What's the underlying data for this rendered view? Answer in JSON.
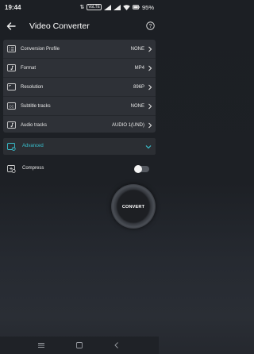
{
  "status_bar": {
    "time": "19:44",
    "battery": "95%",
    "icons": [
      "network-speed-icon",
      "volte-icon",
      "signal-icon",
      "signal-icon",
      "wifi-icon",
      "battery-icon"
    ]
  },
  "app_bar": {
    "title": "Video Converter",
    "back_icon": "arrow-left-icon",
    "help_icon": "question-circle-icon"
  },
  "settings": [
    {
      "label": "Conversion Profile",
      "value": "NONE",
      "icon": "list-box-icon"
    },
    {
      "label": "Format",
      "value": "MP4",
      "icon": "music-note-icon"
    },
    {
      "label": "Resolution",
      "value": "896P",
      "icon": "screen-icon"
    },
    {
      "label": "Subtitle tracks",
      "value": "NONE",
      "icon": "cc-icon"
    },
    {
      "label": "Audio tracks",
      "value": "AUDIO 1(UND)",
      "icon": "music-note-icon"
    }
  ],
  "advanced": {
    "label": "Advanced",
    "accent_color": "#39c1cf"
  },
  "compress": {
    "label": "Compress",
    "enabled": false
  },
  "convert_button": {
    "label": "CONVERT"
  },
  "navigation_bar": [
    "menu-icon",
    "home-icon",
    "back-icon"
  ]
}
